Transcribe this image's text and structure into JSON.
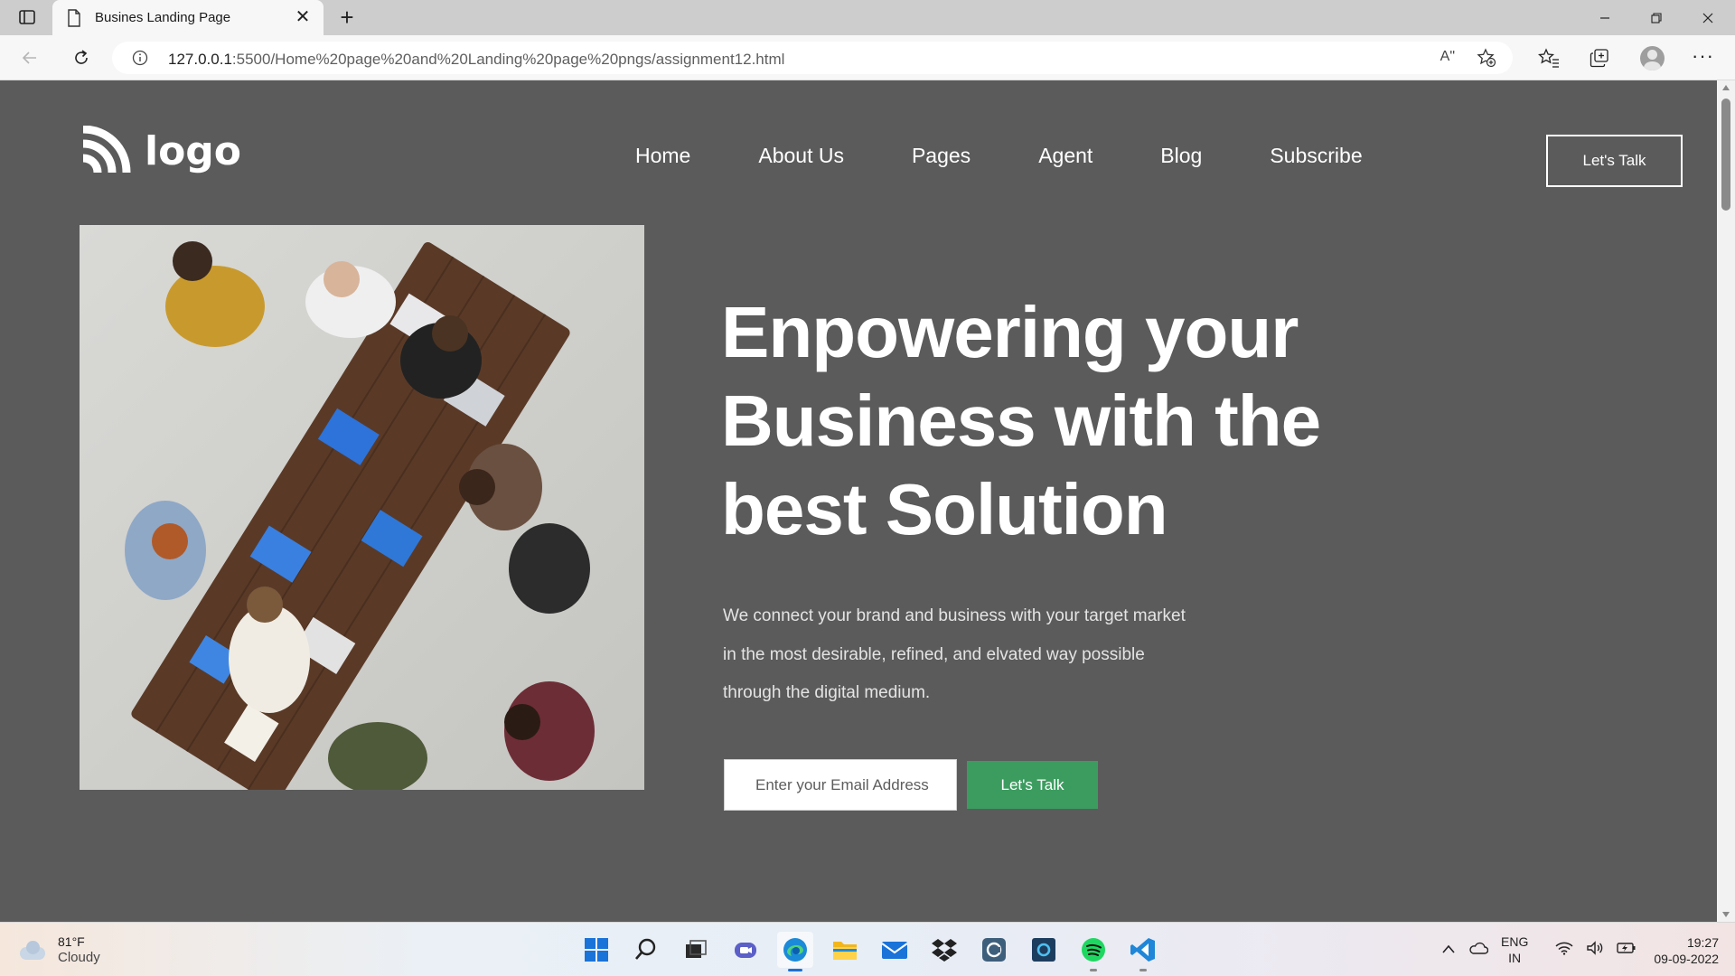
{
  "browser": {
    "tab_title": "Busines Landing Page",
    "tab_close": "✕",
    "new_tab": "+",
    "url_host": "127.0.0.1",
    "url_path": ":5500/Home%20page%20and%20Landing%20page%20pngs/assignment12.html",
    "read_aloud": "Aʺ"
  },
  "site": {
    "logo_text": "logo",
    "nav": [
      "Home",
      "About Us",
      "Pages",
      "Agent",
      "Blog",
      "Subscribe"
    ],
    "header_cta": "Let's Talk",
    "hero_title": "Enpowering your Business with the best Solution",
    "hero_desc": "We connect your brand and business with your target market in the most desirable, refined, and elvated way possible through the digital medium.",
    "email_placeholder": "Enter your Email Address",
    "hero_cta": "Let's Talk",
    "colors": {
      "page_bg": "#5b5b5b",
      "cta_green": "#3c9c5f"
    }
  },
  "taskbar": {
    "weather_temp": "81°F",
    "weather_cond": "Cloudy",
    "lang_1": "ENG",
    "lang_2": "IN",
    "time": "19:27",
    "date": "09-09-2022",
    "apps": [
      "windows-start",
      "search",
      "task-view",
      "teams-chat",
      "edge",
      "file-explorer",
      "mail",
      "dropbox",
      "app-c",
      "cortana",
      "spotify",
      "vscode"
    ]
  }
}
